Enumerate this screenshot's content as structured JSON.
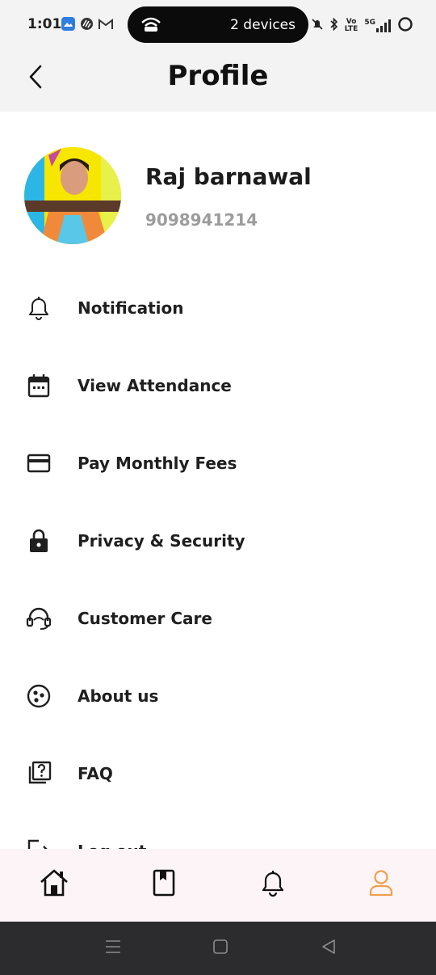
{
  "status_bar": {
    "time": "1:01",
    "devices_text": "2 devices",
    "volte_top": "Vo",
    "volte_bottom": "LTE",
    "network": "5G"
  },
  "header": {
    "title": "Profile"
  },
  "profile": {
    "name": "Raj barnawal",
    "phone": "9098941214"
  },
  "menu": {
    "items": [
      {
        "label": "Notification",
        "icon": "bell-icon"
      },
      {
        "label": "View Attendance",
        "icon": "calendar-icon"
      },
      {
        "label": "Pay Monthly Fees",
        "icon": "credit-card-icon"
      },
      {
        "label": "Privacy & Security",
        "icon": "lock-icon"
      },
      {
        "label": "Customer Care",
        "icon": "headset-icon"
      },
      {
        "label": "About us",
        "icon": "info-circle-icon"
      },
      {
        "label": "FAQ",
        "icon": "faq-icon"
      },
      {
        "label": "Log out",
        "icon": "logout-icon"
      }
    ]
  },
  "bottom_nav": {
    "items": [
      "home-icon",
      "book-icon",
      "bell-icon",
      "profile-icon"
    ],
    "active": "profile-icon",
    "active_color": "#f0a04b"
  },
  "colors": {
    "header_bg": "#f3f3f3",
    "nav_bg": "#fdf4f8",
    "system_nav_bg": "#2c2c2e"
  }
}
